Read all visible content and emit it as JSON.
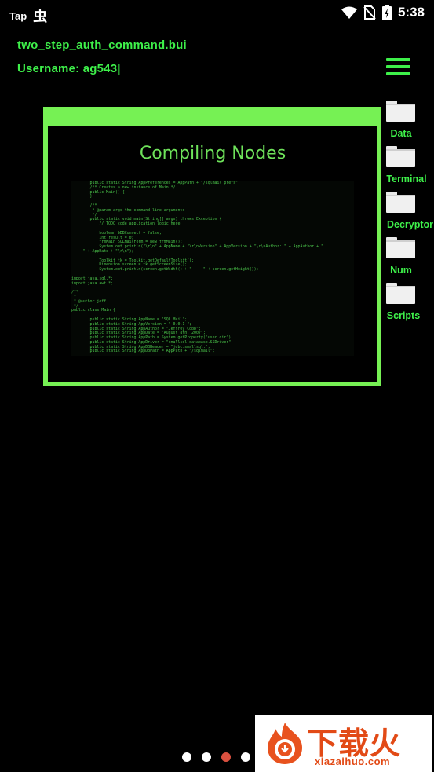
{
  "status_bar": {
    "carrier": "Tap",
    "bug_glyph": "虫",
    "time": "5:38"
  },
  "header": {
    "filename": "two_step_auth_command.bui",
    "username": "Username: ag543|"
  },
  "window": {
    "title": "Compiling Nodes",
    "code_lines": [
      "        public static String AppPreferences = AppPath + \"/sqlmail_prefs\";",
      "        /** Creates a new instance of Main */",
      "        public Main() {",
      "        }",
      "",
      "        /**",
      "         * @param args the command line arguments",
      "         */",
      "        public static void main(String[] args) throws Exception {",
      "            // TODO code application logic here",
      "",
      "            boolean bDBConnect = false;",
      "            int result = 0;",
      "            frmMain SQLMailForm = new frmMain();",
      "            System.out.println(\"\\r\\n\" + AppName + \"\\r\\nVersion\" + AppVersion + \"\\r\\nAuthor: \" + AppAuthor + \"",
      "  -- \" + AppDate + \"\\r\\n\");",
      "",
      "            Toolkit tk = Toolkit.getDefaultToolkit();",
      "            Dimension screen = tk.getScreenSize();",
      "            System.out.println(screen.getWidth() + \" --- \" + screen.getHeight());",
      "",
      "import java.sql.*;",
      "import java.awt.*;",
      "",
      "/**",
      " *",
      " * @author jeff",
      " */",
      "public class Main {",
      "",
      "        public static String AppName = \"SQL Mail\";",
      "        public static String AppVersion = \" 0.0.1 \";",
      "        public static String AppAuthor = \"Jeffrey Cobb\";",
      "        public static String AppDate = \"August 8th, 2007\";",
      "        public static String AppPath = System.getProperty(\"user.dir\");",
      "        public static String AppDriver = \"smallsql.database.SSDriver\";",
      "        public static String AppDBHeader = \"jdbc:smallsql:\";",
      "        public static String AppDBPath = AppPath + \"/sqlmail\";"
    ]
  },
  "folders": [
    {
      "label": "Data",
      "icon": "folder-icon"
    },
    {
      "label": "Terminal",
      "icon": "folder-icon"
    },
    {
      "label": "Decryptor",
      "icon": "folder-icon"
    },
    {
      "label": "Num",
      "icon": "folder-icon"
    },
    {
      "label": "Scripts",
      "icon": "folder-icon"
    }
  ],
  "pagination": {
    "count": 4,
    "active_index": 2
  },
  "watermark": {
    "brand": "下载火",
    "url": "xiazaihuo.com"
  },
  "colors": {
    "accent": "#3ef04a",
    "window_frame": "#76f154",
    "active_dot": "#d9503f",
    "watermark": "#e24a16"
  }
}
